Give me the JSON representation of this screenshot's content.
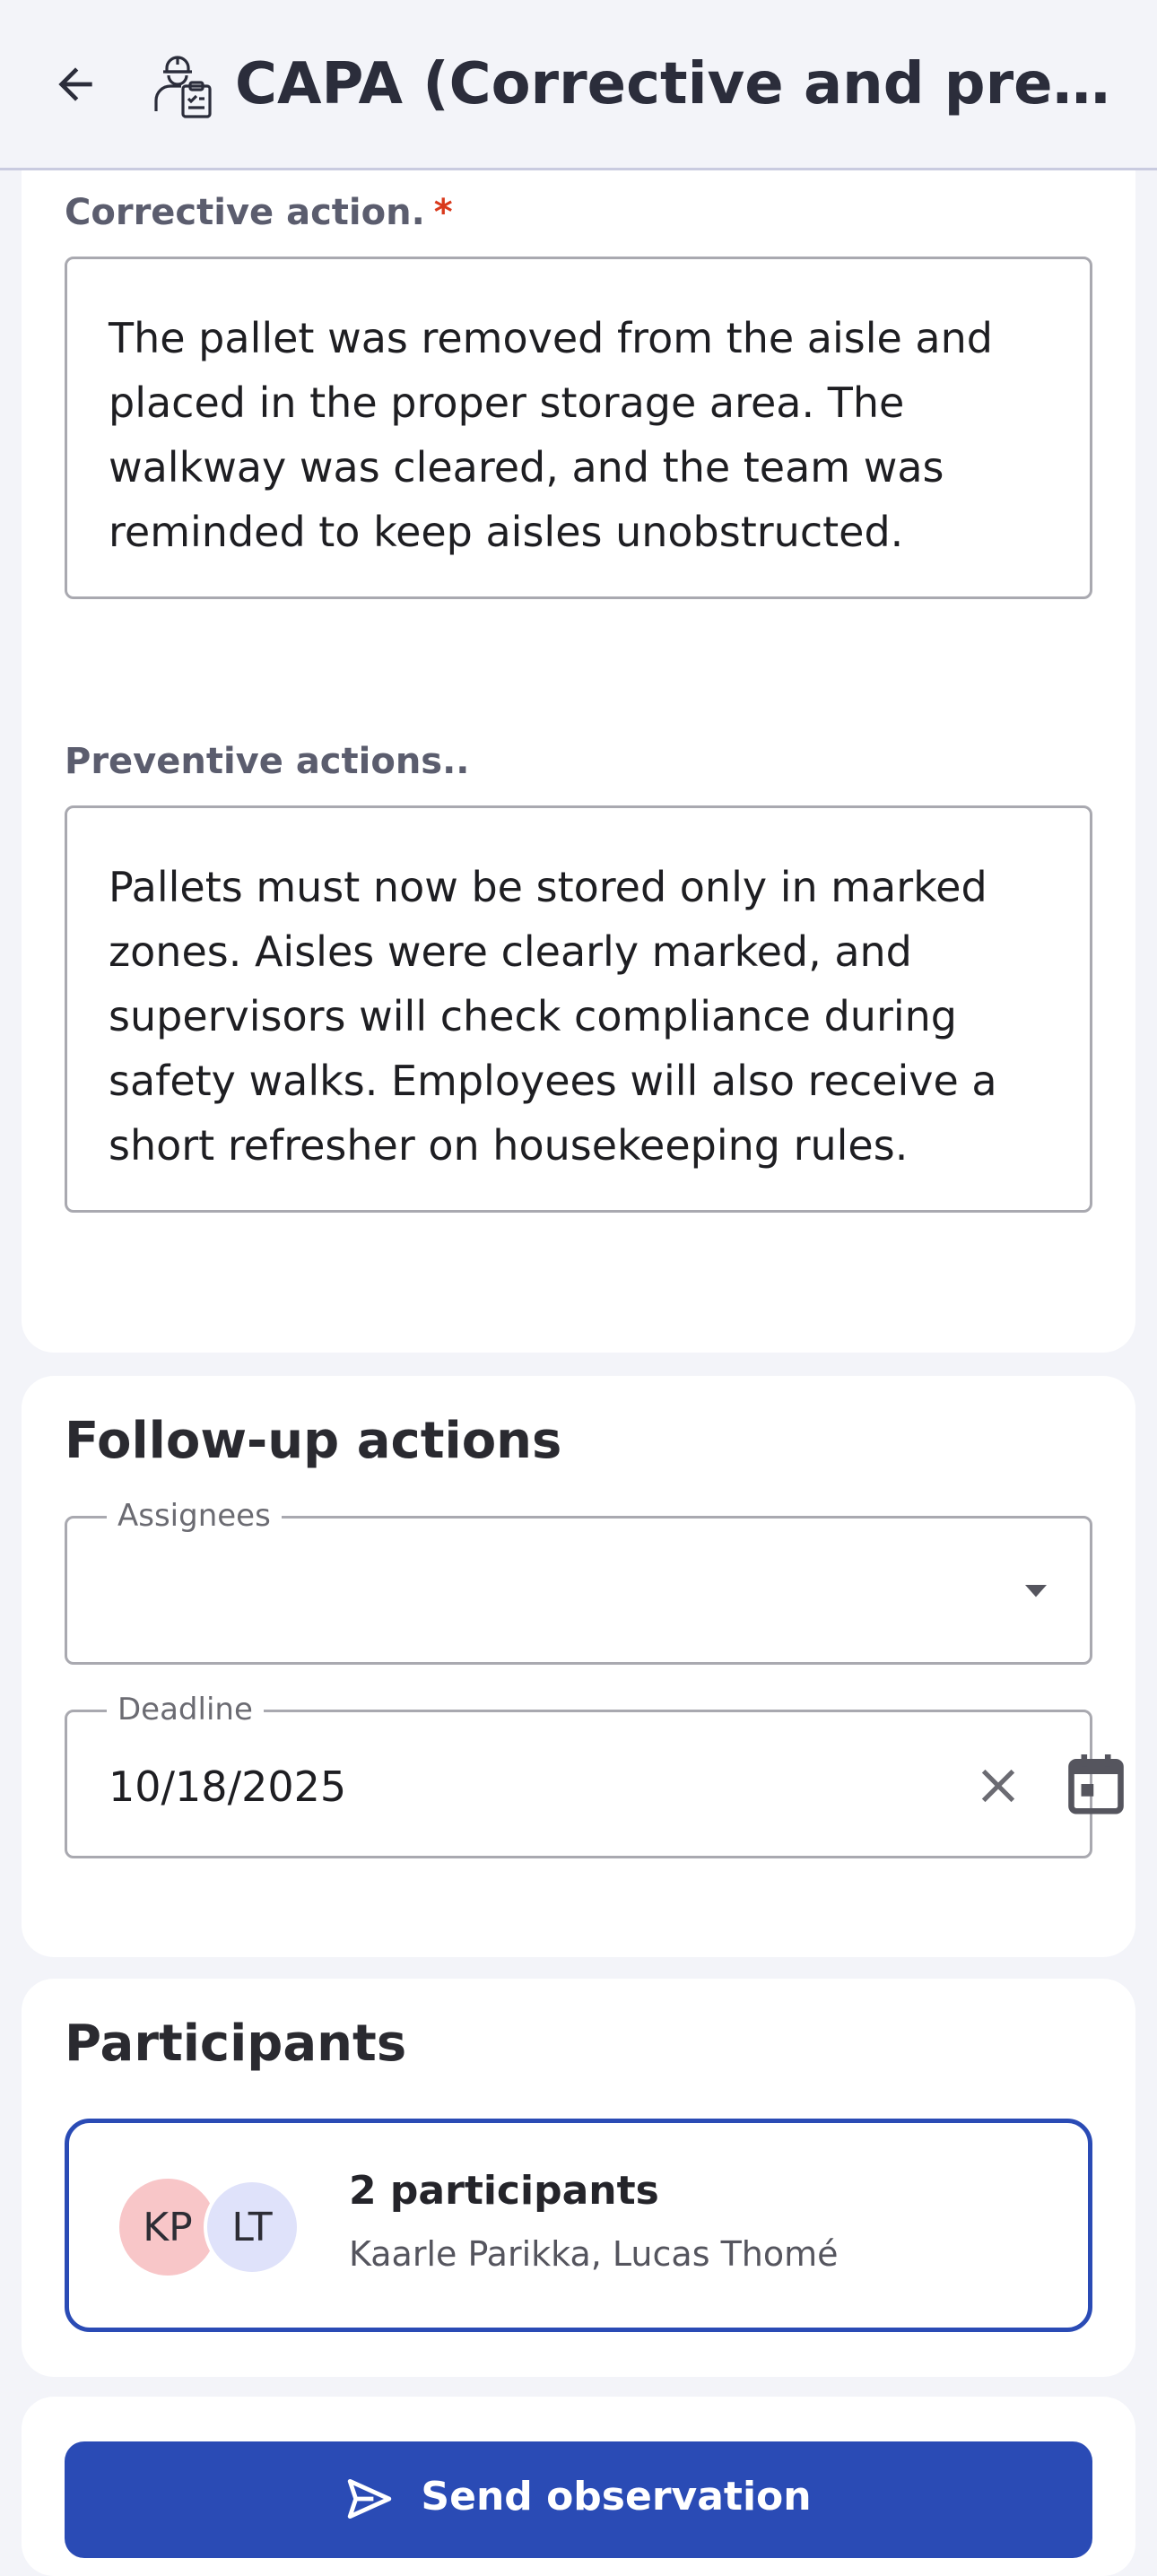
{
  "header": {
    "title": "CAPA (Corrective and prevent…",
    "back_icon": "arrow-left-icon",
    "app_icon": "worker-clipboard-icon"
  },
  "corrective": {
    "label": "Corrective action.",
    "required_mark": "*",
    "text": "The pallet was removed from the aisle and placed in the proper storage area. The walkway was cleared, and the team was reminded to keep aisles unobstructed."
  },
  "preventive": {
    "label": "Preventive actions..",
    "text": "Pallets must now be stored only in marked zones. Aisles were clearly marked, and supervisors will check compliance during safety walks. Employees will also receive a short refresher on housekeeping rules."
  },
  "followup": {
    "title": "Follow-up actions",
    "assignees_label": "Assignees",
    "assignees_value": "",
    "deadline_label": "Deadline",
    "deadline_value": "10/18/2025"
  },
  "participants": {
    "title": "Participants",
    "avatars": [
      "KP",
      "LT"
    ],
    "count_text": "2 participants",
    "names": "Kaarle Parikka, Lucas Thomé"
  },
  "actions": {
    "send_label": "Send observation"
  },
  "colors": {
    "primary": "#2a4bb5",
    "required": "#d9391c",
    "avatar_kp": "#f8c6c8",
    "avatar_lt": "#dfe2fa"
  }
}
